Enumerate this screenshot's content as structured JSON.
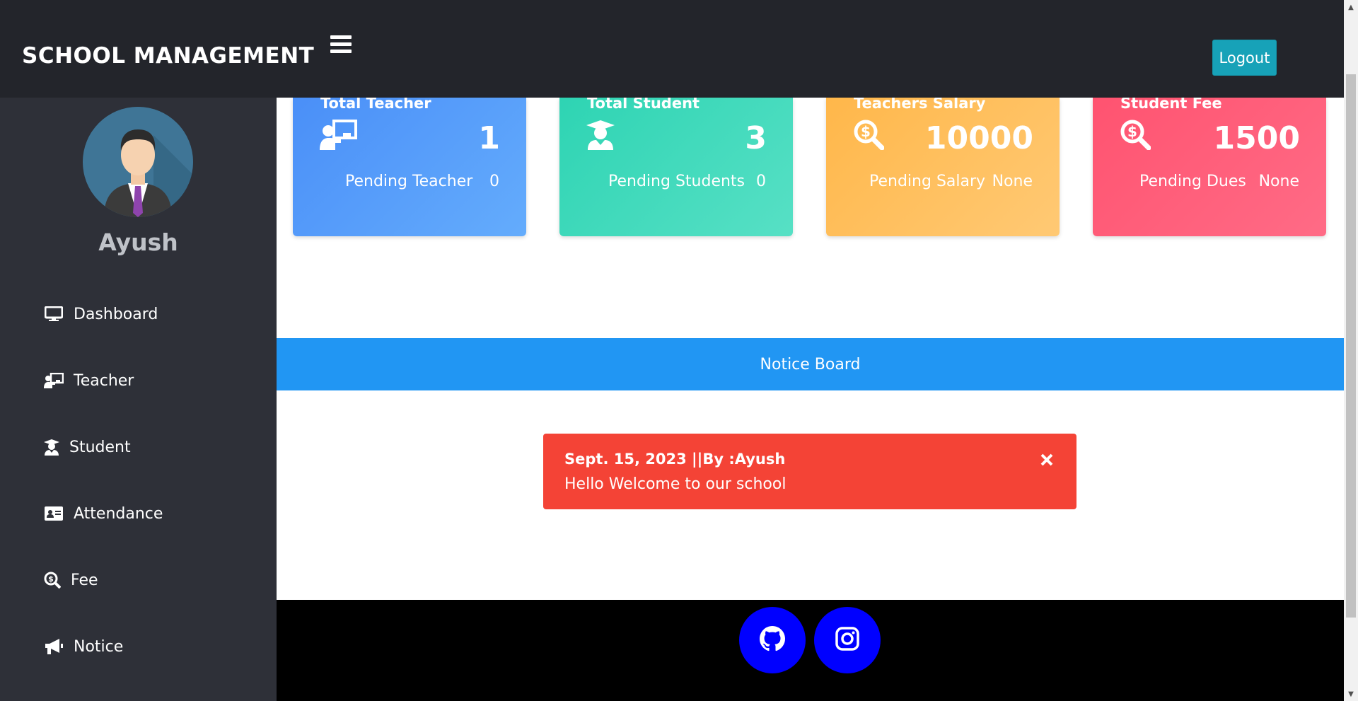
{
  "header": {
    "brand": "SCHOOL MANAGEMENT",
    "logout_label": "Logout",
    "accent_color": "#17a2b8"
  },
  "sidebar": {
    "username": "Ayush",
    "items": [
      {
        "label": "Dashboard",
        "icon": "desktop-icon"
      },
      {
        "label": "Teacher",
        "icon": "chalkboard-teacher-icon"
      },
      {
        "label": "Student",
        "icon": "user-graduate-icon"
      },
      {
        "label": "Attendance",
        "icon": "id-card-icon"
      },
      {
        "label": "Fee",
        "icon": "search-dollar-icon"
      },
      {
        "label": "Notice",
        "icon": "bullhorn-icon"
      }
    ]
  },
  "cards": [
    {
      "title": "Total Teacher",
      "value": "1",
      "pending_label": "Pending Teacher",
      "pending_value": "0",
      "icon": "chalkboard-teacher-icon",
      "color": "#4a8ff8"
    },
    {
      "title": "Total Student",
      "value": "3",
      "pending_label": "Pending Students",
      "pending_value": "0",
      "icon": "user-graduate-icon",
      "color": "#2ed4b3"
    },
    {
      "title": "Teachers Salary",
      "value": "10000",
      "pending_label": "Pending Salary",
      "pending_value": "None",
      "icon": "search-dollar-icon",
      "color": "#ffb74a"
    },
    {
      "title": "Student Fee",
      "value": "1500",
      "pending_label": "Pending Dues",
      "pending_value": "None",
      "icon": "search-dollar-icon",
      "color": "#ff5370"
    }
  ],
  "notice_board": {
    "title": "Notice Board",
    "notices": [
      {
        "header": "Sept. 15, 2023 ||By :Ayush",
        "body": "Hello Welcome to our school"
      }
    ]
  },
  "footer": {
    "links": [
      {
        "icon": "github-icon"
      },
      {
        "icon": "instagram-icon"
      }
    ]
  }
}
